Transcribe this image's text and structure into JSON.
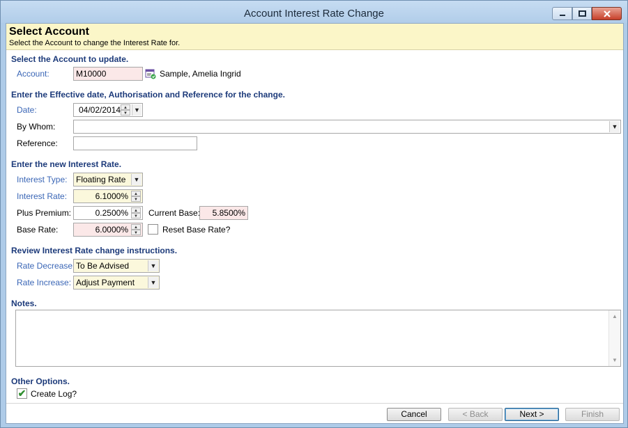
{
  "window": {
    "title": "Account Interest Rate Change",
    "controls": {
      "minimize": "minimize-icon",
      "maximize": "maximize-icon",
      "close": "close-icon"
    }
  },
  "header": {
    "title": "Select Account",
    "subtitle": "Select the Account to change the Interest Rate for."
  },
  "sections": {
    "account": "Select the Account to update.",
    "effective": "Enter the Effective date, Authorisation and Reference for the change.",
    "rate": "Enter the new Interest Rate.",
    "review": "Review Interest Rate change instructions.",
    "notes": "Notes.",
    "options": "Other Options."
  },
  "account": {
    "label": "Account:",
    "value": "M10000",
    "holder": "Sample, Amelia Ingrid"
  },
  "effective": {
    "date_label": "Date:",
    "date_value": "04/02/2014",
    "by_whom_label": "By Whom:",
    "by_whom_value": "",
    "reference_label": "Reference:",
    "reference_value": ""
  },
  "rate": {
    "type_label": "Interest Type:",
    "type_value": "Floating Rate",
    "interest_label": "Interest Rate:",
    "interest_value": "6.1000%",
    "premium_label": "Plus Premium:",
    "premium_value": "0.2500%",
    "current_base_label": "Current Base:",
    "current_base_value": "5.8500%",
    "base_label": "Base Rate:",
    "base_value": "6.0000%",
    "reset_label": "Reset Base Rate?",
    "reset_checked": false
  },
  "review": {
    "decrease_label": "Rate Decrease:",
    "decrease_value": "To Be Advised",
    "increase_label": "Rate Increase:",
    "increase_value": "Adjust Payment"
  },
  "notes": {
    "value": ""
  },
  "options": {
    "create_log_label": "Create Log?",
    "create_log_checked": true,
    "check_glyph": "✔"
  },
  "buttons": {
    "cancel": "Cancel",
    "back": "< Back",
    "next": "Next >",
    "finish": "Finish"
  },
  "colors": {
    "header_bg": "#fbf6c8",
    "section_text": "#1c3a7a",
    "label_blue": "#3a66b6",
    "pink_field": "#fbe8e8",
    "yellow_field": "#fbf8dc"
  }
}
